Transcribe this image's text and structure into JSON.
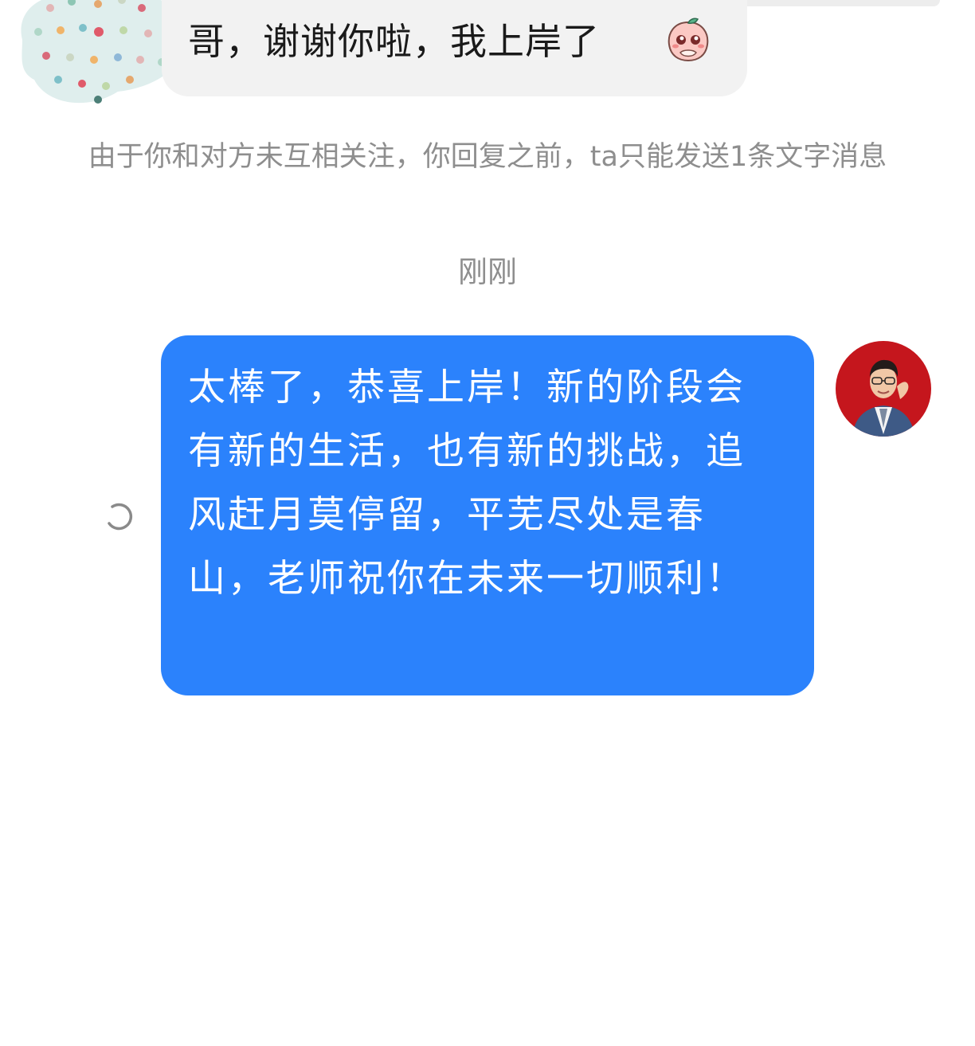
{
  "incoming_message": {
    "text": "哥，谢谢你啦，我上岸了",
    "emoji": "blushing-peach-emoji"
  },
  "system_notice": {
    "text": "由于你和对方未互相关注，你回复之前，ta只能发送1条文字消息"
  },
  "timestamp": "刚刚",
  "outgoing_message": {
    "text": "太棒了，恭喜上岸！新的阶段会有新的生活，也有新的挑战，追风赶月莫停留，平芜尽处是春山，老师祝你在未来一切顺利！",
    "status": "sending"
  },
  "colors": {
    "outgoing_bubble": "#2b82fc",
    "incoming_bubble": "#f2f2f2",
    "meta_text": "#8e8e8e"
  },
  "icons": {
    "left_avatar": "polka-dot-avatar",
    "right_avatar": "teacher-photo-avatar",
    "status": "loading-spinner-icon"
  }
}
